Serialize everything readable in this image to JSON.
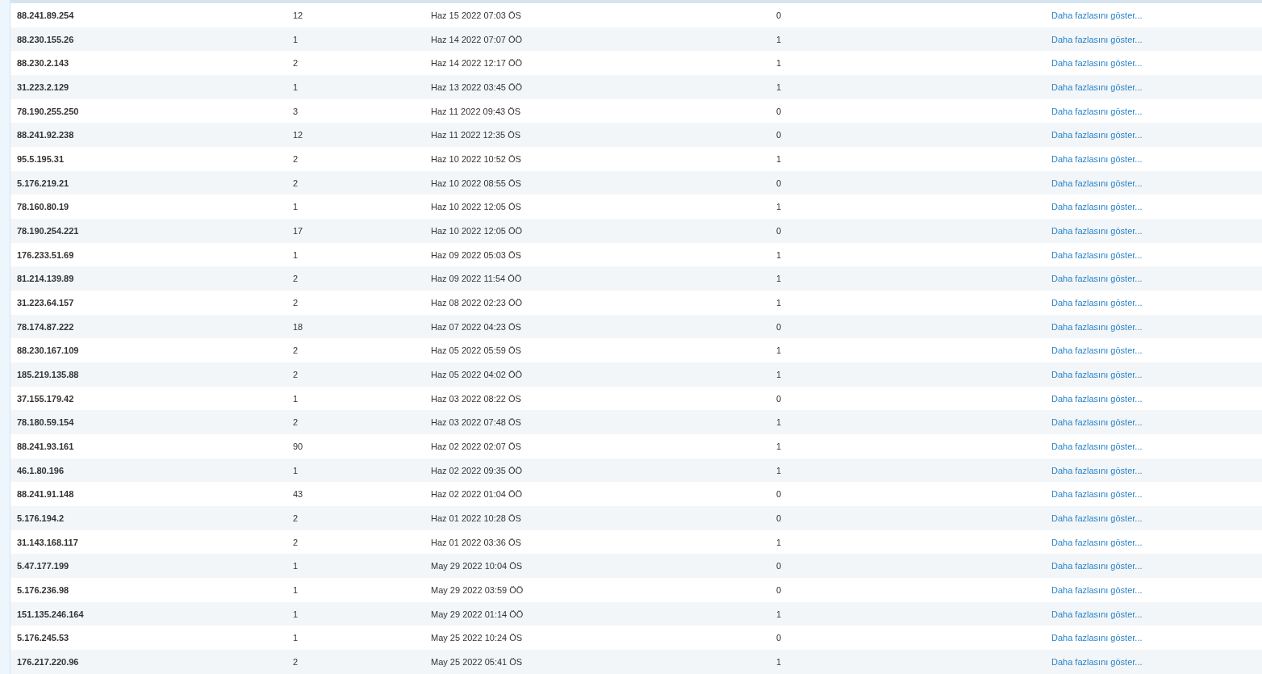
{
  "table": {
    "rows": [
      {
        "column_1": "88.241.89.254",
        "column_2": "12",
        "column_3": "Haz 15 2022 07:03 ÖS",
        "column_4": "0",
        "link": "Daha fazlasını göster..."
      },
      {
        "column_1": "88.230.155.26",
        "column_2": "1",
        "column_3": "Haz 14 2022 07:07 ÖÖ",
        "column_4": "1",
        "link": "Daha fazlasını göster..."
      },
      {
        "column_1": "88.230.2.143",
        "column_2": "2",
        "column_3": "Haz 14 2022 12:17 ÖÖ",
        "column_4": "1",
        "link": "Daha fazlasını göster..."
      },
      {
        "column_1": "31.223.2.129",
        "column_2": "1",
        "column_3": "Haz 13 2022 03:45 ÖÖ",
        "column_4": "1",
        "link": "Daha fazlasını göster..."
      },
      {
        "column_1": "78.190.255.250",
        "column_2": "3",
        "column_3": "Haz 11 2022 09:43 ÖS",
        "column_4": "0",
        "link": "Daha fazlasını göster..."
      },
      {
        "column_1": "88.241.92.238",
        "column_2": "12",
        "column_3": "Haz 11 2022 12:35 ÖS",
        "column_4": "0",
        "link": "Daha fazlasını göster..."
      },
      {
        "column_1": "95.5.195.31",
        "column_2": "2",
        "column_3": "Haz 10 2022 10:52 ÖS",
        "column_4": "1",
        "link": "Daha fazlasını göster..."
      },
      {
        "column_1": "5.176.219.21",
        "column_2": "2",
        "column_3": "Haz 10 2022 08:55 ÖS",
        "column_4": "0",
        "link": "Daha fazlasını göster..."
      },
      {
        "column_1": "78.160.80.19",
        "column_2": "1",
        "column_3": "Haz 10 2022 12:05 ÖS",
        "column_4": "1",
        "link": "Daha fazlasını göster..."
      },
      {
        "column_1": "78.190.254.221",
        "column_2": "17",
        "column_3": "Haz 10 2022 12:05 ÖÖ",
        "column_4": "0",
        "link": "Daha fazlasını göster..."
      },
      {
        "column_1": "176.233.51.69",
        "column_2": "1",
        "column_3": "Haz 09 2022 05:03 ÖS",
        "column_4": "1",
        "link": "Daha fazlasını göster..."
      },
      {
        "column_1": "81.214.139.89",
        "column_2": "2",
        "column_3": "Haz 09 2022 11:54 ÖÖ",
        "column_4": "1",
        "link": "Daha fazlasını göster..."
      },
      {
        "column_1": "31.223.64.157",
        "column_2": "2",
        "column_3": "Haz 08 2022 02:23 ÖÖ",
        "column_4": "1",
        "link": "Daha fazlasını göster..."
      },
      {
        "column_1": "78.174.87.222",
        "column_2": "18",
        "column_3": "Haz 07 2022 04:23 ÖS",
        "column_4": "0",
        "link": "Daha fazlasını göster..."
      },
      {
        "column_1": "88.230.167.109",
        "column_2": "2",
        "column_3": "Haz 05 2022 05:59 ÖS",
        "column_4": "1",
        "link": "Daha fazlasını göster..."
      },
      {
        "column_1": "185.219.135.88",
        "column_2": "2",
        "column_3": "Haz 05 2022 04:02 ÖÖ",
        "column_4": "1",
        "link": "Daha fazlasını göster..."
      },
      {
        "column_1": "37.155.179.42",
        "column_2": "1",
        "column_3": "Haz 03 2022 08:22 ÖS",
        "column_4": "0",
        "link": "Daha fazlasını göster..."
      },
      {
        "column_1": "78.180.59.154",
        "column_2": "2",
        "column_3": "Haz 03 2022 07:48 ÖS",
        "column_4": "1",
        "link": "Daha fazlasını göster..."
      },
      {
        "column_1": "88.241.93.161",
        "column_2": "90",
        "column_3": "Haz 02 2022 02:07 ÖS",
        "column_4": "1",
        "link": "Daha fazlasını göster..."
      },
      {
        "column_1": "46.1.80.196",
        "column_2": "1",
        "column_3": "Haz 02 2022 09:35 ÖÖ",
        "column_4": "1",
        "link": "Daha fazlasını göster..."
      },
      {
        "column_1": "88.241.91.148",
        "column_2": "43",
        "column_3": "Haz 02 2022 01:04 ÖÖ",
        "column_4": "0",
        "link": "Daha fazlasını göster..."
      },
      {
        "column_1": "5.176.194.2",
        "column_2": "2",
        "column_3": "Haz 01 2022 10:28 ÖS",
        "column_4": "0",
        "link": "Daha fazlasını göster..."
      },
      {
        "column_1": "31.143.168.117",
        "column_2": "2",
        "column_3": "Haz 01 2022 03:36 ÖS",
        "column_4": "1",
        "link": "Daha fazlasını göster..."
      },
      {
        "column_1": "5.47.177.199",
        "column_2": "1",
        "column_3": "May 29 2022 10:04 ÖS",
        "column_4": "0",
        "link": "Daha fazlasını göster..."
      },
      {
        "column_1": "5.176.236.98",
        "column_2": "1",
        "column_3": "May 29 2022 03:59 ÖÖ",
        "column_4": "0",
        "link": "Daha fazlasını göster..."
      },
      {
        "column_1": "151.135.246.164",
        "column_2": "1",
        "column_3": "May 29 2022 01:14 ÖÖ",
        "column_4": "1",
        "link": "Daha fazlasını göster..."
      },
      {
        "column_1": "5.176.245.53",
        "column_2": "1",
        "column_3": "May 25 2022 10:24 ÖS",
        "column_4": "0",
        "link": "Daha fazlasını göster..."
      },
      {
        "column_1": "176.217.220.96",
        "column_2": "2",
        "column_3": "May 25 2022 05:41 ÖS",
        "column_4": "1",
        "link": "Daha fazlasını göster..."
      }
    ]
  }
}
